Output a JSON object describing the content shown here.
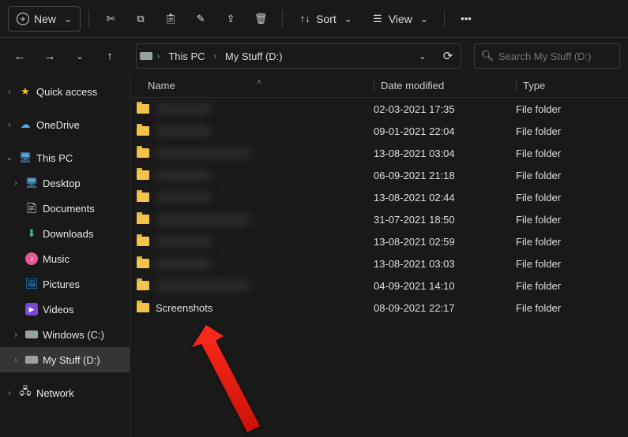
{
  "toolbar": {
    "new_label": "New",
    "sort_label": "Sort",
    "view_label": "View"
  },
  "breadcrumb": {
    "seg1": "This PC",
    "seg2": "My Stuff (D:)"
  },
  "search": {
    "placeholder": "Search My Stuff (D:)"
  },
  "sidebar": {
    "quick": "Quick access",
    "onedrive": "OneDrive",
    "thispc": "This PC",
    "desktop": "Desktop",
    "documents": "Documents",
    "downloads": "Downloads",
    "music": "Music",
    "pictures": "Pictures",
    "videos": "Videos",
    "windowsC": "Windows (C:)",
    "mystuffD": "My Stuff (D:)",
    "network": "Network"
  },
  "columns": {
    "name": "Name",
    "date": "Date modified",
    "type": "Type"
  },
  "type_folder": "File folder",
  "items": [
    {
      "name_hidden": true,
      "name": "████",
      "date": "02-03-2021 17:35"
    },
    {
      "name_hidden": true,
      "name": "█████",
      "date": "09-01-2021 22:04"
    },
    {
      "name_hidden": true,
      "name": "████████",
      "date": "13-08-2021 03:04"
    },
    {
      "name_hidden": true,
      "name": "████",
      "date": "06-09-2021 21:18"
    },
    {
      "name_hidden": true,
      "name": "█████",
      "date": "13-08-2021 02:44"
    },
    {
      "name_hidden": true,
      "name": "███",
      "date": "31-07-2021 18:50"
    },
    {
      "name_hidden": true,
      "name": "█████",
      "date": "13-08-2021 02:59"
    },
    {
      "name_hidden": true,
      "name": "████",
      "date": "13-08-2021 03:03"
    },
    {
      "name_hidden": true,
      "name": "██",
      "date": "04-09-2021 14:10"
    },
    {
      "name_hidden": false,
      "name": "Screenshots",
      "date": "08-09-2021 22:17"
    }
  ]
}
